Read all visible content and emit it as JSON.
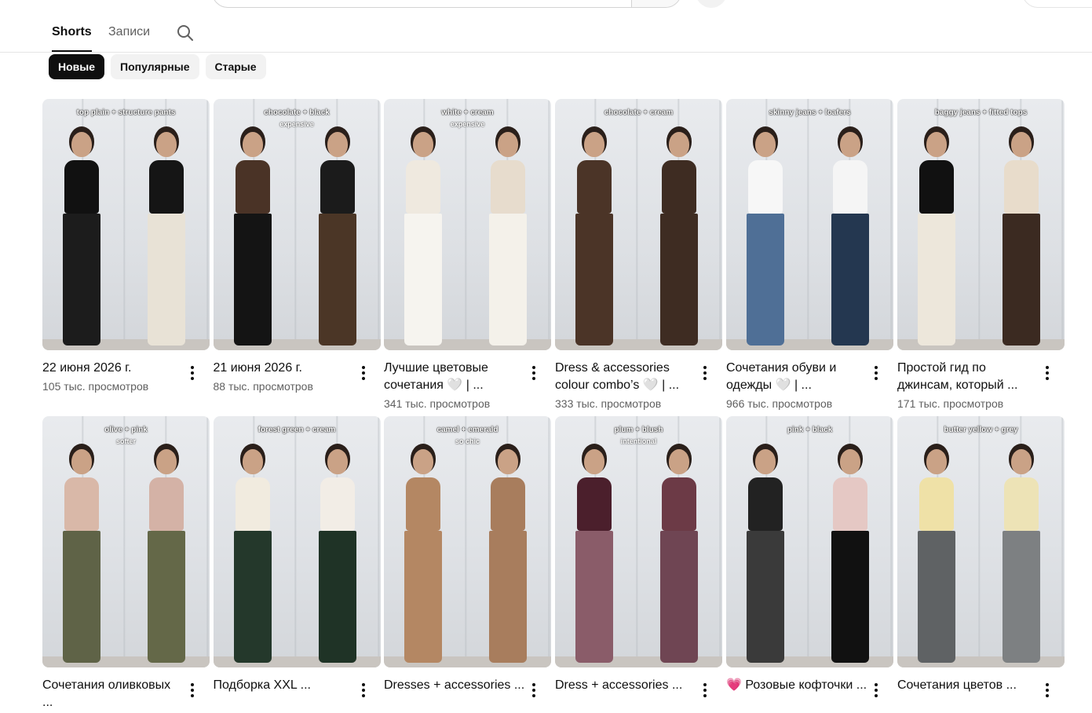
{
  "tabs": [
    {
      "label": "Shorts",
      "active": true
    },
    {
      "label": "Записи",
      "active": false
    }
  ],
  "filters": [
    {
      "label": "Новые",
      "selected": true
    },
    {
      "label": "Популярные",
      "selected": false
    },
    {
      "label": "Старые",
      "selected": false
    }
  ],
  "row1": [
    {
      "title": "22 июня 2026 г.",
      "views": "105 тыс. просмотров",
      "caption": "top plain + structure pants",
      "sub": "",
      "colors": [
        "#111111",
        "#1c1c1c",
        "#151515",
        "#e8e2d6"
      ]
    },
    {
      "title": "21 июня 2026 г.",
      "views": "88 тыс. просмотров",
      "caption": "chocolate + black",
      "sub": "expensive",
      "colors": [
        "#4a3326",
        "#141414",
        "#1b1b1b",
        "#4b3626"
      ]
    },
    {
      "title": "Лучшие цветовые сочетания 🤍 | ...",
      "views": "341 тыс. просмотров",
      "caption": "white + cream",
      "sub": "expensive",
      "colors": [
        "#efe9df",
        "#f6f4ef",
        "#e7dccd",
        "#f4f1ea"
      ]
    },
    {
      "title": "Dress & accessories colour combo’s 🤍 | ...",
      "views": "333 тыс. просмотров",
      "caption": "chocolate + cream",
      "sub": "",
      "colors": [
        "#4b3427",
        "#4b3427",
        "#3e2c22",
        "#3e2c22"
      ]
    },
    {
      "title": "Сочетания обуви и одежды 🤍 | ...",
      "views": "966 тыс. просмотров",
      "caption": "skinny jeans + loafers",
      "sub": "",
      "colors": [
        "#f7f7f7",
        "#4f6f96",
        "#f5f5f5",
        "#243750"
      ]
    },
    {
      "title": "Простой гид по джинсам, который ...",
      "views": "171 тыс. просмотров",
      "caption": "baggy jeans + fitted tops",
      "sub": "",
      "colors": [
        "#111111",
        "#ede7db",
        "#e8dccb",
        "#3b2a21"
      ]
    }
  ],
  "row2": [
    {
      "title": "Сочетания оливковых ...",
      "views": "",
      "caption": "olive + pink",
      "sub": "softer",
      "colors": [
        "#d9b8a8",
        "#5f6347",
        "#d4b2a6",
        "#646848"
      ]
    },
    {
      "title": "Подборка XXL ...",
      "views": "",
      "caption": "forest green + cream",
      "sub": "",
      "colors": [
        "#f1ebdf",
        "#24382b",
        "#f2ede6",
        "#1f3326"
      ]
    },
    {
      "title": "Dresses + accessories ...",
      "views": "",
      "caption": "camel + emerald",
      "sub": "so chic",
      "colors": [
        "#b48763",
        "#b48763",
        "#a87d5d",
        "#a87d5d"
      ]
    },
    {
      "title": "Dress + accessories ...",
      "views": "",
      "caption": "plum + blush",
      "sub": "intentional",
      "colors": [
        "#4b1f2c",
        "#8a5c69",
        "#6c3a46",
        "#6f4553"
      ]
    },
    {
      "title": "💗 Розовые кофточки ...",
      "views": "",
      "caption": "pink + black",
      "sub": "",
      "colors": [
        "#222222",
        "#3a3a3a",
        "#e5c8c4",
        "#111111"
      ]
    },
    {
      "title": "Сочетания цветов ...",
      "views": "",
      "caption": "butter yellow + grey",
      "sub": "",
      "colors": [
        "#efe1a7",
        "#5f6264",
        "#ede3b6",
        "#7d8082"
      ]
    }
  ]
}
